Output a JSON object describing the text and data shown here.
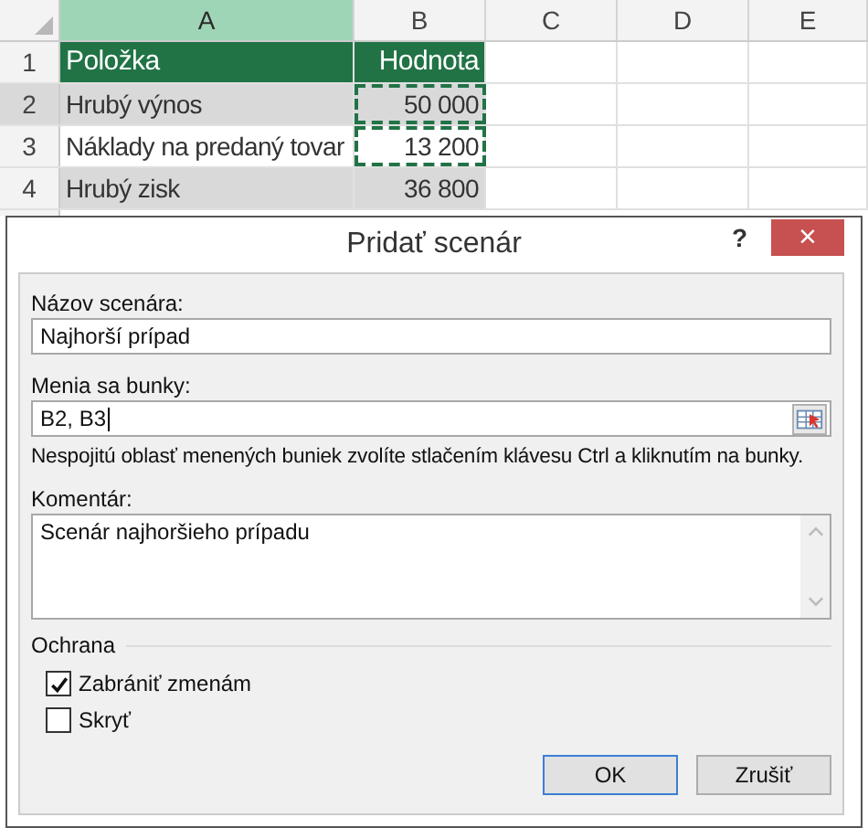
{
  "sheet": {
    "columns": [
      {
        "label": "A",
        "selected": true
      },
      {
        "label": "B",
        "selected": false
      },
      {
        "label": "C",
        "selected": false
      },
      {
        "label": "D",
        "selected": false
      },
      {
        "label": "E",
        "selected": false
      }
    ],
    "rows": [
      {
        "number": "1",
        "kind": "header",
        "selected": false,
        "cells": [
          {
            "text": "Položka",
            "marked": false
          },
          {
            "text": "Hodnota",
            "marked": false
          }
        ]
      },
      {
        "number": "2",
        "kind": "shaded",
        "selected": true,
        "cells": [
          {
            "text": "Hrubý výnos",
            "marked": false
          },
          {
            "text": "50 000",
            "marked": true
          }
        ]
      },
      {
        "number": "3",
        "kind": "plain",
        "selected": false,
        "cells": [
          {
            "text": "Náklady na predaný tovar",
            "marked": false
          },
          {
            "text": "13 200",
            "marked": true
          }
        ]
      },
      {
        "number": "4",
        "kind": "shaded",
        "selected": false,
        "cells": [
          {
            "text": "Hrubý zisk",
            "marked": false
          },
          {
            "text": "36 800",
            "marked": false
          }
        ]
      }
    ]
  },
  "dialog": {
    "title": "Pridať scenár",
    "help": "?",
    "close": "×",
    "name_label": "Názov scenára:",
    "name_value": "Najhorší prípad",
    "cells_label": "Menia sa bunky:",
    "cells_value": "B2, B3",
    "hint": "Nespojitú oblasť menených buniek zvolíte stlačením klávesu Ctrl a kliknutím na bunky.",
    "comment_label": "Komentár:",
    "comment_value": "Scenár najhoršieho prípadu",
    "protection_label": "Ochrana",
    "options": [
      {
        "label": "Zabrániť zmenám",
        "checked": true
      },
      {
        "label": "Skryť",
        "checked": false
      }
    ],
    "buttons": [
      {
        "label": "OK",
        "kind": "default"
      },
      {
        "label": "Zrušiť",
        "kind": "normal"
      }
    ]
  }
}
